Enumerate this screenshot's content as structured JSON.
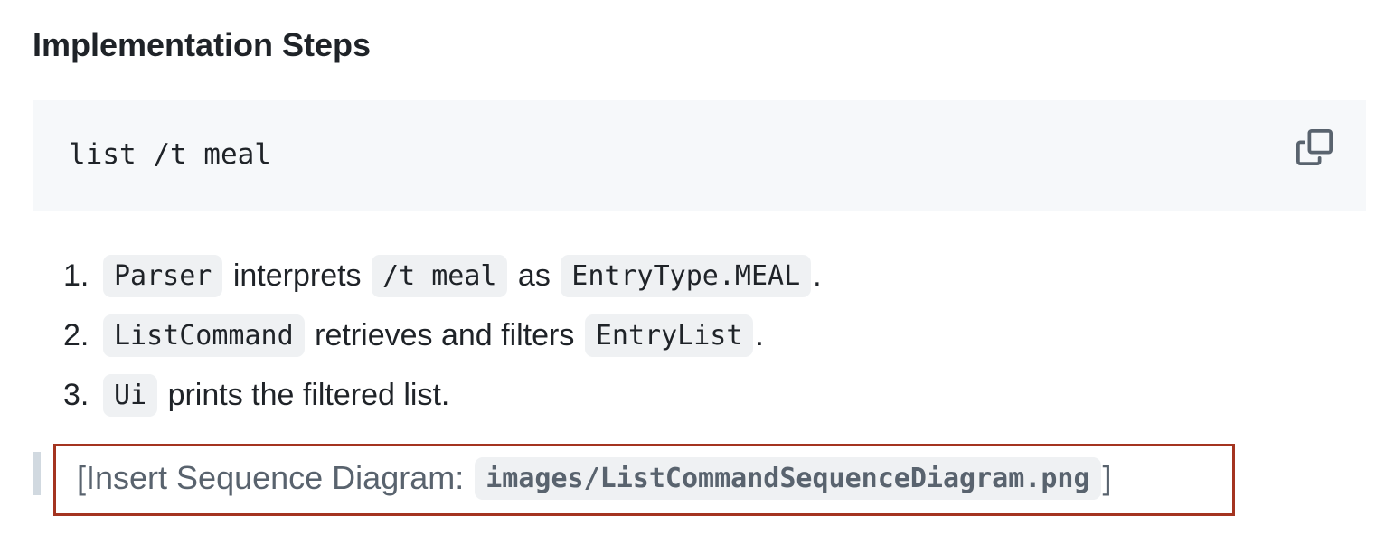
{
  "section": {
    "heading": "Implementation Steps"
  },
  "code_block": {
    "content": "list /t meal",
    "copy_icon": "copy-icon"
  },
  "steps": [
    {
      "number": "1.",
      "parts": [
        {
          "code": "Parser"
        },
        {
          "text": "interprets"
        },
        {
          "code": "/t meal"
        },
        {
          "text": "as"
        },
        {
          "code": "EntryType.MEAL"
        },
        {
          "text": "."
        }
      ]
    },
    {
      "number": "2.",
      "parts": [
        {
          "code": "ListCommand"
        },
        {
          "text": "retrieves and filters"
        },
        {
          "code": "EntryList"
        },
        {
          "text": "."
        }
      ]
    },
    {
      "number": "3.",
      "parts": [
        {
          "code": "Ui"
        },
        {
          "text": "prints the filtered list."
        }
      ]
    }
  ],
  "placeholder": {
    "prefix": "[Insert Sequence Diagram:",
    "code": "images/ListCommandSequenceDiagram.png",
    "suffix": "]"
  },
  "colors": {
    "highlight_border": "#a43420",
    "code_bg": "#f6f8fa",
    "inline_code_bg": "#eff1f3",
    "quote_bar": "#d1d9e0",
    "quote_text": "#59636e"
  }
}
